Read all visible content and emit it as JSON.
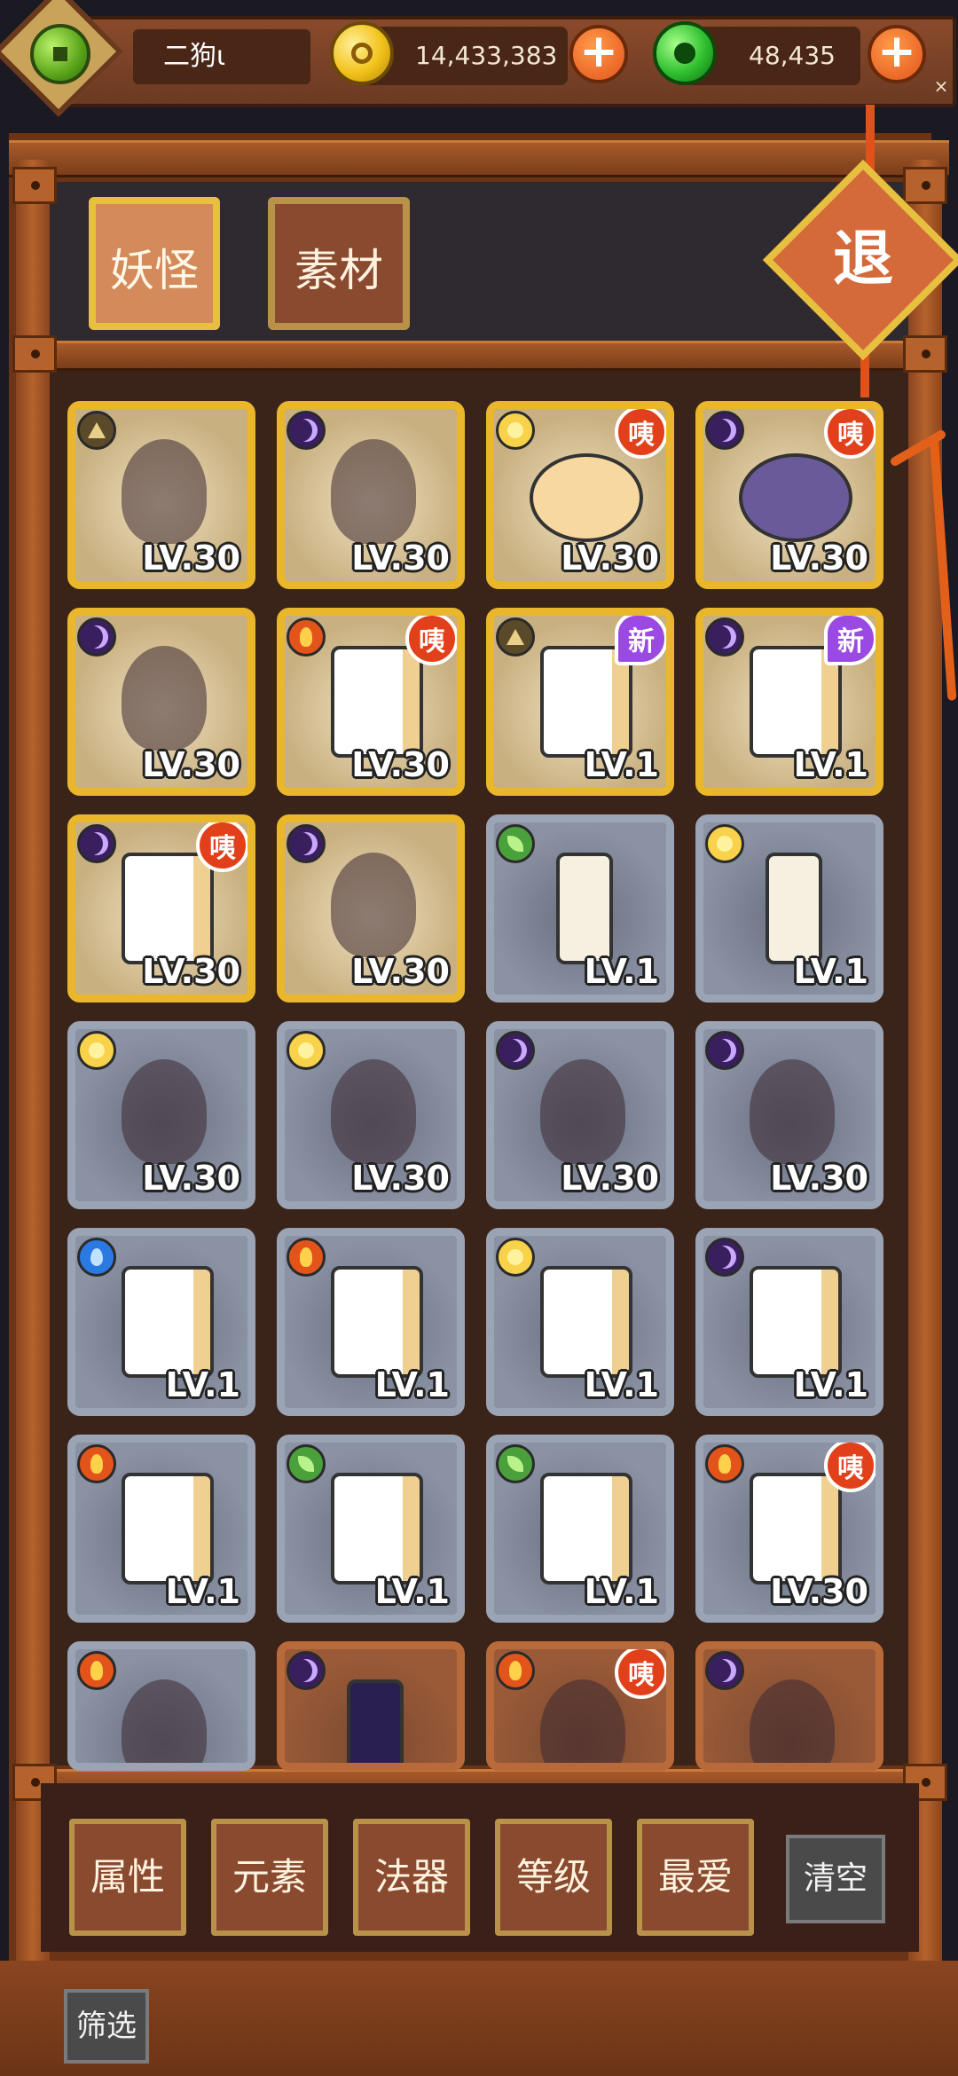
{
  "header": {
    "player_name": "二狗ι",
    "gold_amount": "14,433,383",
    "jade_amount": "48,435",
    "add_gold_label": "+",
    "add_jade_label": "+",
    "close_label": "×"
  },
  "tabs": [
    {
      "label": "妖怪",
      "active": true
    },
    {
      "label": "素材",
      "active": false
    }
  ],
  "exit_label": "退",
  "grid": [
    {
      "frame": "gold",
      "element": "earth",
      "art": "white-wolf-demon",
      "level": "LV.30",
      "badge": ""
    },
    {
      "frame": "gold",
      "element": "moon",
      "art": "black-panther-girl",
      "level": "LV.30",
      "badge": ""
    },
    {
      "frame": "gold",
      "element": "sun",
      "art": "xiangqi-piece-xiang",
      "level": "LV.30",
      "badge": "咦"
    },
    {
      "frame": "gold",
      "element": "moon",
      "art": "xiangqi-piece-xiang-purple",
      "level": "LV.30",
      "badge": "咦"
    },
    {
      "frame": "gold",
      "element": "moon",
      "art": "bearded-general",
      "level": "LV.30",
      "badge": ""
    },
    {
      "frame": "gold",
      "element": "fire",
      "art": "mahjong-tile-bamboo",
      "level": "LV.30",
      "badge": "咦"
    },
    {
      "frame": "gold",
      "element": "earth",
      "art": "mahjong-tile-bamboo-9",
      "level": "LV.1",
      "badge": "新"
    },
    {
      "frame": "gold",
      "element": "moon",
      "art": "mahjong-tile-jiu-wan",
      "level": "LV.1",
      "badge": "新"
    },
    {
      "frame": "gold",
      "element": "moon",
      "art": "mahjong-tile-qi-wan",
      "level": "LV.30",
      "badge": "咦"
    },
    {
      "frame": "gold",
      "element": "moon",
      "art": "purple-spiky-demon",
      "level": "LV.30",
      "badge": ""
    },
    {
      "frame": "gray",
      "element": "leaf",
      "art": "chess-rook-white",
      "level": "LV.1",
      "badge": ""
    },
    {
      "frame": "gray",
      "element": "sun",
      "art": "chess-king-white",
      "level": "LV.1",
      "badge": ""
    },
    {
      "frame": "gray",
      "element": "sun",
      "art": "horned-girl-red",
      "level": "LV.30",
      "badge": ""
    },
    {
      "frame": "gray",
      "element": "sun",
      "art": "green-chariot",
      "level": "LV.30",
      "badge": ""
    },
    {
      "frame": "gray",
      "element": "moon",
      "art": "horned-girl-purple",
      "level": "LV.30",
      "badge": ""
    },
    {
      "frame": "gray",
      "element": "moon",
      "art": "purple-chariot",
      "level": "LV.30",
      "badge": ""
    },
    {
      "frame": "gray",
      "element": "water",
      "art": "mahjong-tile-bamboo-6",
      "level": "LV.1",
      "badge": ""
    },
    {
      "frame": "gray",
      "element": "fire",
      "art": "mahjong-tile-bamboo-5",
      "level": "LV.1",
      "badge": ""
    },
    {
      "frame": "gray",
      "element": "sun",
      "art": "mahjong-tile-bamboo-4",
      "level": "LV.1",
      "badge": ""
    },
    {
      "frame": "gray",
      "element": "moon",
      "art": "mahjong-tile-liu-wan",
      "level": "LV.1",
      "badge": ""
    },
    {
      "frame": "gray",
      "element": "fire",
      "art": "mahjong-tile-wu-wan",
      "level": "LV.1",
      "badge": ""
    },
    {
      "frame": "gray",
      "element": "leaf",
      "art": "mahjong-tile-si-wan",
      "level": "LV.1",
      "badge": ""
    },
    {
      "frame": "gray",
      "element": "leaf",
      "art": "mahjong-tile-dots-6",
      "level": "LV.1",
      "badge": ""
    },
    {
      "frame": "gray",
      "element": "fire",
      "art": "mahjong-tile-dots-5",
      "level": "LV.30",
      "badge": "咦"
    },
    {
      "frame": "gray",
      "element": "fire",
      "art": "lion-warrior-kid",
      "level": "",
      "badge": ""
    },
    {
      "frame": "bronze",
      "element": "moon",
      "art": "chess-knight-dark",
      "level": "",
      "badge": ""
    },
    {
      "frame": "bronze",
      "element": "fire",
      "art": "white-horse-rider",
      "level": "",
      "badge": "咦"
    },
    {
      "frame": "bronze",
      "element": "moon",
      "art": "dark-blob-monster",
      "level": "",
      "badge": ""
    }
  ],
  "filters": {
    "buttons": [
      "属性",
      "元素",
      "法器",
      "等级",
      "最爱"
    ],
    "clear_label": "清空",
    "screen_label": "筛选"
  },
  "colors": {
    "frame_gold": "#eab72c",
    "frame_gray": "#9aa4b4",
    "frame_bronze": "#b86a3a",
    "badge_love": "#e2401a",
    "badge_new": "#9a4ae2"
  }
}
